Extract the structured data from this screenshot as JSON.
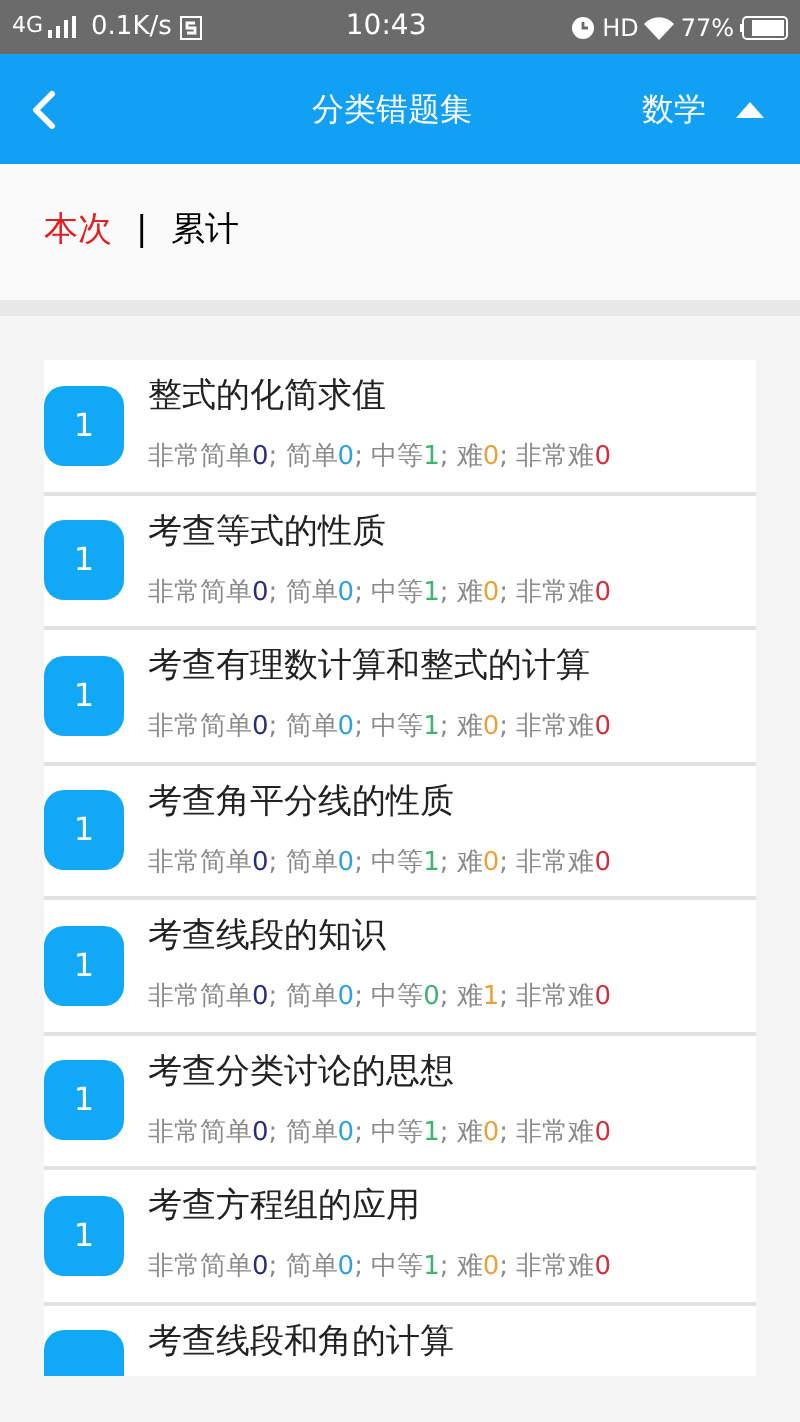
{
  "status_bar": {
    "network": "4G",
    "speed": "0.1K/s",
    "time": "10:43",
    "hd": "HD",
    "battery": "77%"
  },
  "header": {
    "title": "分类错题集",
    "subject": "数学"
  },
  "tabs": [
    {
      "label": "本次",
      "selected": true
    },
    {
      "label": "累计",
      "selected": false
    }
  ],
  "tab_separator": "|",
  "items": [
    {
      "count": "1",
      "title": "整式的化简求值",
      "stats": [
        {
          "label": "非常简单",
          "value": "0",
          "color": "#2b2d7c"
        },
        {
          "label": "; 简单",
          "value": "0",
          "color": "#2ba3e0"
        },
        {
          "label": "; 中等",
          "value": "1",
          "color": "#3cb46e"
        },
        {
          "label": "; 难",
          "value": "0",
          "color": "#e8a23c"
        },
        {
          "label": "; 非常难",
          "value": "0",
          "color": "#d0303c"
        }
      ]
    },
    {
      "count": "1",
      "title": "考查等式的性质",
      "stats": [
        {
          "label": "非常简单",
          "value": "0",
          "color": "#2b2d7c"
        },
        {
          "label": "; 简单",
          "value": "0",
          "color": "#2ba3e0"
        },
        {
          "label": "; 中等",
          "value": "1",
          "color": "#3cb46e"
        },
        {
          "label": "; 难",
          "value": "0",
          "color": "#e8a23c"
        },
        {
          "label": "; 非常难",
          "value": "0",
          "color": "#d0303c"
        }
      ]
    },
    {
      "count": "1",
      "title": "考查有理数计算和整式的计算",
      "stats": [
        {
          "label": "非常简单",
          "value": "0",
          "color": "#2b2d7c"
        },
        {
          "label": "; 简单",
          "value": "0",
          "color": "#2ba3e0"
        },
        {
          "label": "; 中等",
          "value": "1",
          "color": "#3cb46e"
        },
        {
          "label": "; 难",
          "value": "0",
          "color": "#e8a23c"
        },
        {
          "label": "; 非常难",
          "value": "0",
          "color": "#d0303c"
        }
      ]
    },
    {
      "count": "1",
      "title": "考查角平分线的性质",
      "stats": [
        {
          "label": "非常简单",
          "value": "0",
          "color": "#2b2d7c"
        },
        {
          "label": "; 简单",
          "value": "0",
          "color": "#2ba3e0"
        },
        {
          "label": "; 中等",
          "value": "1",
          "color": "#3cb46e"
        },
        {
          "label": "; 难",
          "value": "0",
          "color": "#e8a23c"
        },
        {
          "label": "; 非常难",
          "value": "0",
          "color": "#d0303c"
        }
      ]
    },
    {
      "count": "1",
      "title": "考查线段的知识",
      "stats": [
        {
          "label": "非常简单",
          "value": "0",
          "color": "#2b2d7c"
        },
        {
          "label": "; 简单",
          "value": "0",
          "color": "#2ba3e0"
        },
        {
          "label": "; 中等",
          "value": "0",
          "color": "#3cb46e"
        },
        {
          "label": "; 难",
          "value": "1",
          "color": "#e8a23c"
        },
        {
          "label": "; 非常难",
          "value": "0",
          "color": "#d0303c"
        }
      ]
    },
    {
      "count": "1",
      "title": "考查分类讨论的思想",
      "stats": [
        {
          "label": "非常简单",
          "value": "0",
          "color": "#2b2d7c"
        },
        {
          "label": "; 简单",
          "value": "0",
          "color": "#2ba3e0"
        },
        {
          "label": "; 中等",
          "value": "1",
          "color": "#3cb46e"
        },
        {
          "label": "; 难",
          "value": "0",
          "color": "#e8a23c"
        },
        {
          "label": "; 非常难",
          "value": "0",
          "color": "#d0303c"
        }
      ]
    },
    {
      "count": "1",
      "title": "考查方程组的应用",
      "stats": [
        {
          "label": "非常简单",
          "value": "0",
          "color": "#2b2d7c"
        },
        {
          "label": "; 简单",
          "value": "0",
          "color": "#2ba3e0"
        },
        {
          "label": "; 中等",
          "value": "1",
          "color": "#3cb46e"
        },
        {
          "label": "; 难",
          "value": "0",
          "color": "#e8a23c"
        },
        {
          "label": "; 非常难",
          "value": "0",
          "color": "#d0303c"
        }
      ]
    },
    {
      "title": "考查线段和角的计算"
    }
  ]
}
